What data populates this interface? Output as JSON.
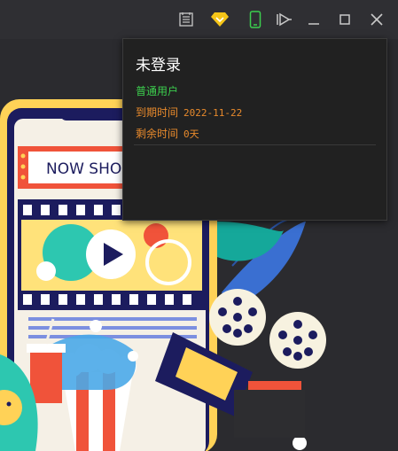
{
  "toolbar": {
    "icons": [
      "notes-icon",
      "vip-diamond-icon",
      "phone-icon",
      "screen-cast-icon",
      "minimize-icon",
      "maximize-icon",
      "close-icon"
    ],
    "vip_color": "#f5c518",
    "phone_color": "#3ccf4e"
  },
  "account_popup": {
    "title": "未登录",
    "tier": "普通用户",
    "expiry_label": "到期时间",
    "expiry_value": "2022-11-22",
    "remaining_label": "剩余时间",
    "remaining_value": "0天",
    "tier_color": "#3ccf4e",
    "info_color": "#e88a2c"
  },
  "poster": {
    "sign_text": "NOW SHO"
  }
}
